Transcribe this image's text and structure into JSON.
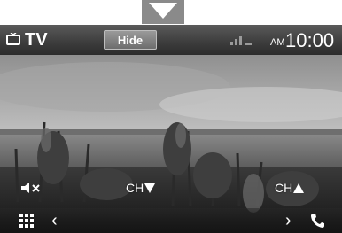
{
  "header": {
    "source_icon": "tv-icon",
    "title": "TV",
    "hide_label": "Hide",
    "status_icon": "signal-status-icon",
    "ampm": "AM",
    "time": "10:00"
  },
  "controls": {
    "mute_icon": "mute-icon",
    "ch_down_label": "CH",
    "ch_up_label": "CH"
  },
  "bottom": {
    "menu_icon": "grid-menu-icon",
    "prev_glyph": "‹",
    "next_glyph": "›",
    "phone_icon": "phone-icon"
  },
  "colors": {
    "bar": "#3c3c3c",
    "text": "#ffffff",
    "indicator": "#8a8a8a"
  }
}
